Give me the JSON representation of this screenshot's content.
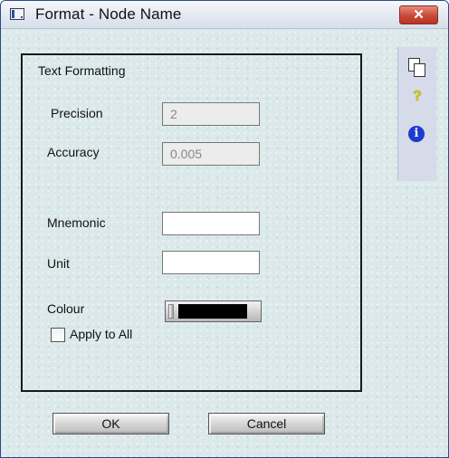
{
  "window": {
    "title": "Format - Node Name",
    "close_label": "✕"
  },
  "group": {
    "title": "Text Formatting"
  },
  "fields": {
    "precision": {
      "label": "Precision",
      "value": "2"
    },
    "accuracy": {
      "label": "Accuracy",
      "value": "0.005"
    },
    "mnemonic": {
      "label": "Mnemonic",
      "value": ""
    },
    "unit": {
      "label": "Unit",
      "value": ""
    },
    "colour": {
      "label": "Colour",
      "value": "#000000"
    }
  },
  "apply_all": {
    "label": "Apply to All",
    "checked": false
  },
  "buttons": {
    "ok": "OK",
    "cancel": "Cancel"
  },
  "side_icons": {
    "help": "?",
    "info": "i"
  },
  "colors": {
    "title_bar": "#e3e9f2",
    "close_button": "#c84a37",
    "client_background": "#dce9ea",
    "side_panel": "#d6dbe9",
    "info_icon": "#1e3bd0",
    "help_icon": "#d4c300"
  }
}
